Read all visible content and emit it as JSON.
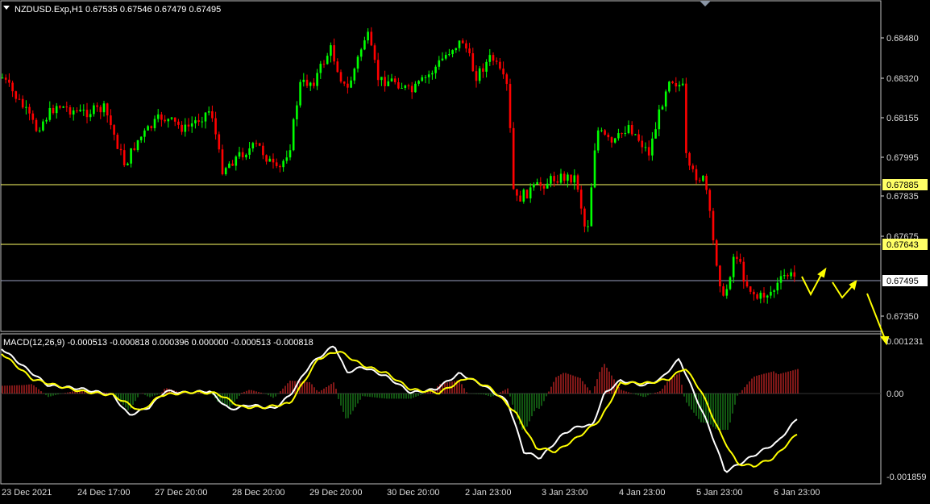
{
  "header": {
    "symbol_line": "NZDUSD.Exp,H1  0.67535 0.67546 0.67479 0.67495",
    "macd_line": "MACD(12,26,9) -0.000513 -0.000818 0.000396 0.000000 -0.000513 -0.000818"
  },
  "colors": {
    "background": "#000000",
    "bull": "#00ff00",
    "bear": "#ff0000",
    "grid": "#c0c0c0",
    "hline_yellow": "#ffff66",
    "hline_grey": "#9aa0c0",
    "macd_main": "#ffffff",
    "macd_signal": "#ffff00",
    "hist_pos": "#ff3030",
    "hist_neg": "#22aa22"
  },
  "price_axis": {
    "ticks": [
      "0.68480",
      "0.68320",
      "0.68155",
      "0.67995",
      "0.67835",
      "0.67675",
      "0.67350"
    ],
    "levels": [
      {
        "label": "0.67885",
        "style": "yellow"
      },
      {
        "label": "0.67643",
        "style": "yellow"
      },
      {
        "label": "0.67495",
        "style": "current"
      }
    ]
  },
  "macd_axis": {
    "ticks": [
      "0.001231",
      "0.00",
      "-0.001859"
    ]
  },
  "time_axis": {
    "labels": [
      "23 Dec 2021",
      "24 Dec 17:00",
      "27 Dec 20:00",
      "28 Dec 20:00",
      "29 Dec 20:00",
      "30 Dec 20:00",
      "2 Jan 23:00",
      "3 Jan 23:00",
      "4 Jan 23:00",
      "5 Jan 23:00",
      "6 Jan 23:00"
    ]
  },
  "projection_icon": "yellow-zigzag-arrows"
}
